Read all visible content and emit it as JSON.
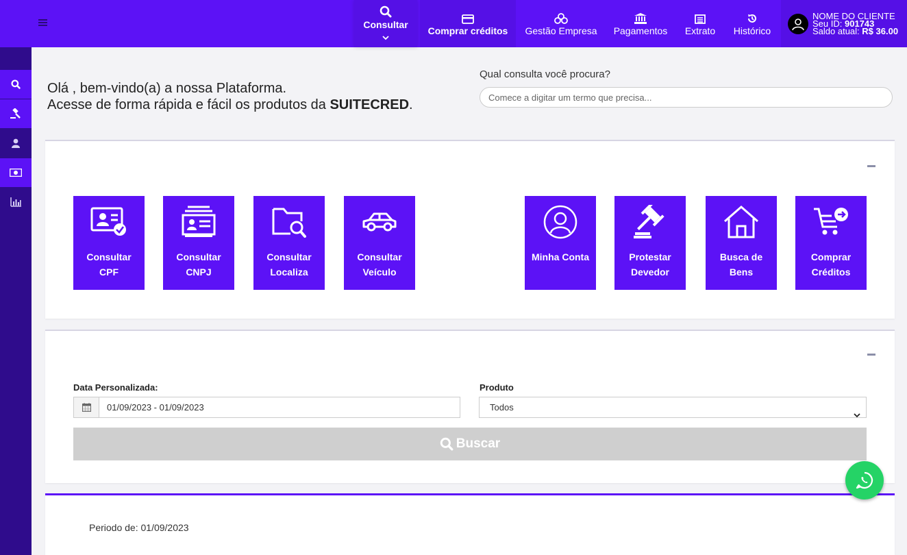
{
  "header": {
    "nav": [
      {
        "label": "Consultar",
        "icon": "search-icon"
      },
      {
        "label": "Comprar créditos",
        "icon": "credit-card-icon"
      },
      {
        "label": "Gestão Empresa",
        "icon": "coins-icon"
      },
      {
        "label": "Pagamentos",
        "icon": "bank-icon"
      },
      {
        "label": "Extrato",
        "icon": "receipt-icon"
      },
      {
        "label": "Histórico",
        "icon": "history-icon"
      }
    ],
    "user": {
      "name": "NOME DO CLIENTE",
      "id_label": "Seu ID:",
      "id_value": "901743",
      "balance_label": "Saldo atual:",
      "balance_value": "R$ 36.00"
    }
  },
  "sidebar": {
    "items": [
      {
        "icon": "search-icon"
      },
      {
        "icon": "gavel-icon"
      },
      {
        "icon": "user-icon"
      },
      {
        "icon": "money-icon"
      },
      {
        "icon": "bar-chart-icon"
      }
    ]
  },
  "welcome": {
    "line1": "Olá , bem-vindo(a) a nossa Plataforma.",
    "line2_prefix": "Acesse de forma rápida e fácil os produtos da",
    "brand": "SUITECRED",
    "line2_suffix": "."
  },
  "search": {
    "label": "Qual consulta você procura?",
    "placeholder": "Comece a digitar um termo que precisa..."
  },
  "tiles": [
    {
      "line1": "Consultar",
      "line2": "CPF",
      "icon": "id-card-check-icon"
    },
    {
      "line1": "Consultar",
      "line2": "CNPJ",
      "icon": "company-id-icon"
    },
    {
      "line1": "Consultar",
      "line2": "Localiza",
      "icon": "folder-search-icon"
    },
    {
      "line1": "Consultar",
      "line2": "Veículo",
      "icon": "car-icon"
    },
    {
      "line1": "Minha Conta",
      "line2": "",
      "icon": "user-circle-icon"
    },
    {
      "line1": "Protestar",
      "line2": "Devedor",
      "icon": "gavel-icon"
    },
    {
      "line1": "Busca de",
      "line2": "Bens",
      "icon": "house-icon"
    },
    {
      "line1": "Comprar",
      "line2": "Créditos",
      "icon": "cart-arrow-icon"
    }
  ],
  "filters": {
    "date_label": "Data Personalizada:",
    "date_value": "01/09/2023 - 01/09/2023",
    "product_label": "Produto",
    "product_selected": "Todos",
    "search_button": "Buscar"
  },
  "results": {
    "period_text": "Periodo de: 01/09/2023"
  },
  "colors": {
    "primary": "#5c12f6",
    "sidebar": "#2f0c8c",
    "whatsapp": "#25d366"
  }
}
